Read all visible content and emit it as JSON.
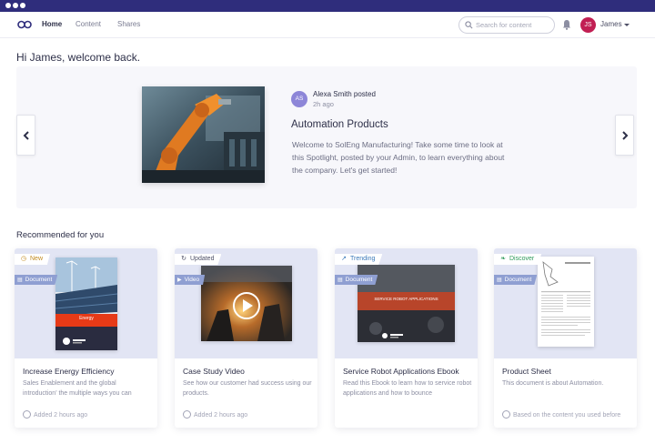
{
  "nav": {
    "links": [
      "Home",
      "Content",
      "Shares"
    ],
    "search_placeholder": "Search for content",
    "user_initials": "JS",
    "user_name": "James"
  },
  "greeting": "Hi James, welcome back.",
  "spotlight": {
    "author_initials": "AS",
    "author": "Alexa Smith posted",
    "time": "2h ago",
    "title": "Automation Products",
    "description": "Welcome to SolEng Manufacturing! Take some time to look at this Spotlight, posted by your Admin, to learn everything about the company. Let's get started!"
  },
  "recommended_title": "Recommended for you",
  "cards": [
    {
      "status": "New",
      "status_icon": "clock-icon",
      "type": "Document",
      "title": "Increase Energy Efficiency",
      "description": "Sales Enablement and the global introduction' the multiple ways you can",
      "footer": "Added 2 hours ago",
      "thumb_label": "Energy"
    },
    {
      "status": "Updated",
      "status_icon": "refresh-icon",
      "type": "Video",
      "title": "Case Study Video",
      "description": "See how our customer had success using our products.",
      "footer": "Added 2 hours ago"
    },
    {
      "status": "Trending",
      "status_icon": "trend-icon",
      "type": "Document",
      "title": "Service Robot Applications Ebook",
      "description": "Read this Ebook to learn how to service robot applications and how to bounce",
      "footer": "",
      "thumb_label": "SERVICE ROBOT APPLICATIONS"
    },
    {
      "status": "Discover",
      "status_icon": "leaf-icon",
      "type": "Document",
      "title": "Product Sheet",
      "description": "This document is about Automation.",
      "footer": "Based on the content you used before"
    }
  ],
  "colors": {
    "chrome": "#2f2d7c",
    "avatar": "#c11f53",
    "accent_tag": "#8f9fd2"
  }
}
